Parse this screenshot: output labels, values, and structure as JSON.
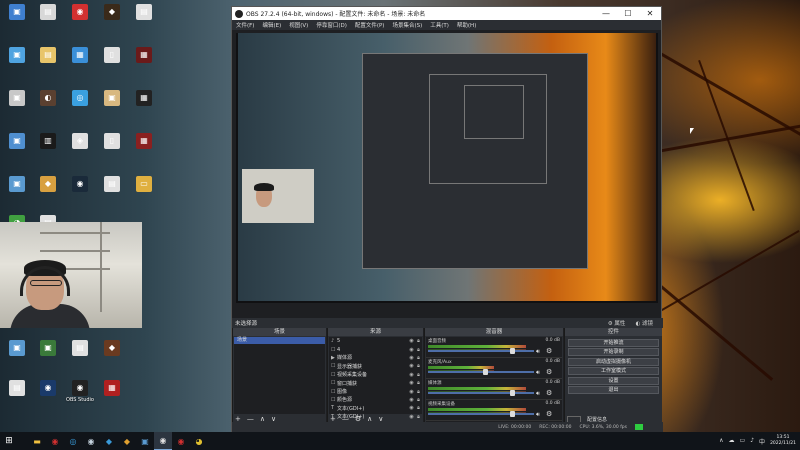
{
  "desktop": {
    "icons_left": [
      {
        "label": "",
        "color": "#3f7fcf",
        "glyph": "▣"
      },
      {
        "label": "",
        "color": "#d8d8d8",
        "glyph": "▤"
      },
      {
        "label": "",
        "color": "#d23030",
        "glyph": "◉"
      },
      {
        "label": "",
        "color": "#3a2a1a",
        "glyph": "◆"
      },
      {
        "label": "",
        "color": "#e0e0e0",
        "glyph": "▤"
      },
      {
        "label": "",
        "color": "#4fa3e0",
        "glyph": "▣"
      },
      {
        "label": "",
        "color": "#e8c56a",
        "glyph": "▤"
      },
      {
        "label": "",
        "color": "#3a8fd8",
        "glyph": "▦"
      },
      {
        "label": "",
        "color": "#e0e0e0",
        "glyph": "▯"
      },
      {
        "label": "",
        "color": "#6a1a1a",
        "glyph": "▦"
      },
      {
        "label": "",
        "color": "#c8c8c8",
        "glyph": "▣"
      },
      {
        "label": "",
        "color": "#5a4030",
        "glyph": "◐"
      },
      {
        "label": "",
        "color": "#3aa0e0",
        "glyph": "◎"
      },
      {
        "label": "",
        "color": "#d8b880",
        "glyph": "▣"
      },
      {
        "label": "",
        "color": "#222222",
        "glyph": "▦"
      },
      {
        "label": "",
        "color": "#4f8fd0",
        "glyph": "▣"
      },
      {
        "label": "",
        "color": "#1a1a1a",
        "glyph": "▥"
      },
      {
        "label": "",
        "color": "#e0e0e0",
        "glyph": "◈"
      },
      {
        "label": "",
        "color": "#e0e0e0",
        "glyph": "▯"
      },
      {
        "label": "",
        "color": "#8a2020",
        "glyph": "▦"
      },
      {
        "label": "",
        "color": "#5a9ad0",
        "glyph": "▣"
      },
      {
        "label": "",
        "color": "#d8a040",
        "glyph": "◆"
      },
      {
        "label": "",
        "color": "#1a2a3a",
        "glyph": "◉"
      },
      {
        "label": "",
        "color": "#e0e0e0",
        "glyph": "▤"
      },
      {
        "label": "",
        "color": "#e0b040",
        "glyph": "▭"
      },
      {
        "label": "",
        "color": "#40a040",
        "glyph": "◔"
      },
      {
        "label": "",
        "color": "#e0e0e0",
        "glyph": "▤"
      }
    ],
    "icons_bottom": [
      {
        "label": "",
        "color": "#5a9ad0",
        "glyph": "▣"
      },
      {
        "label": "",
        "color": "#3a7a3a",
        "glyph": "▣"
      },
      {
        "label": "",
        "color": "#e0e0e0",
        "glyph": "▤"
      },
      {
        "label": "",
        "color": "#6a3a20",
        "glyph": "◆"
      },
      {
        "label": "",
        "color": "#e0e0e0",
        "glyph": "▤"
      },
      {
        "label": "",
        "color": "#1a3a6a",
        "glyph": "◉"
      },
      {
        "label": "OBS Studio",
        "color": "#222222",
        "glyph": "◉"
      },
      {
        "label": "",
        "color": "#b02020",
        "glyph": "▦"
      }
    ]
  },
  "obs": {
    "title": "OBS 27.2.4 (64-bit, windows) - 配置文件: 未命名 - 场景: 未命名",
    "menu": [
      "文件(F)",
      "编辑(E)",
      "视图(V)",
      "停靠窗口(D)",
      "配置文件(P)",
      "场景集合(S)",
      "工具(T)",
      "帮助(H)"
    ],
    "scene_bar": {
      "label": "未选择源",
      "properties": "⚙ 属性",
      "filters": "◐ 滤镜"
    },
    "docks": {
      "scenes": {
        "title": "场景",
        "items": [
          "场景"
        ],
        "footer": [
          "+",
          "—",
          "∧",
          "∨"
        ]
      },
      "sources": {
        "title": "来源",
        "items": [
          {
            "icon": "♪",
            "name": "5"
          },
          {
            "icon": "☐",
            "name": "4"
          },
          {
            "icon": "▶",
            "name": "媒体源"
          },
          {
            "icon": "☐",
            "name": "显示器捕获"
          },
          {
            "icon": "☐",
            "name": "视频采集设备"
          },
          {
            "icon": "☐",
            "name": "窗口捕获"
          },
          {
            "icon": "☐",
            "name": "图像"
          },
          {
            "icon": "☐",
            "name": "颜色源"
          },
          {
            "icon": "T",
            "name": "文本(GDI+)"
          },
          {
            "icon": "T",
            "name": "文本(GDI+)"
          }
        ],
        "footer": [
          "+",
          "—",
          "⚙",
          "∧",
          "∨"
        ]
      },
      "mixer": {
        "title": "混音器",
        "tracks": [
          {
            "name": "桌面音频",
            "db": "0.0 dB",
            "level": 0.82
          },
          {
            "name": "麦克风/Aux",
            "db": "0.0 dB",
            "level": 0.55
          },
          {
            "name": "媒体源",
            "db": "0.0 dB",
            "level": 0.82
          },
          {
            "name": "视频采集设备",
            "db": "0.0 dB",
            "level": 0.82
          }
        ]
      },
      "controls": {
        "title": "控件",
        "buttons": [
          "开始推流",
          "开始录制",
          "启动虚拟摄像机",
          "工作室模式",
          "设置",
          "退出"
        ],
        "footer": [
          "",
          "配置信息"
        ]
      }
    },
    "status": {
      "dropped": "LIVE: 00:00:00",
      "rec": "REC: 00:00:00",
      "cpu": "CPU: 3.6%, 30.00 fps"
    }
  },
  "taskbar": {
    "start_icon": "windows-logo",
    "apps": [
      {
        "name": "file-explorer",
        "glyph": "▬",
        "color": "#f0c040"
      },
      {
        "name": "netease-music",
        "glyph": "◉",
        "color": "#d23030"
      },
      {
        "name": "qq-browser",
        "glyph": "◎",
        "color": "#3aa0e0"
      },
      {
        "name": "steam",
        "glyph": "◉",
        "color": "#c6d4df"
      },
      {
        "name": "battle-net",
        "glyph": "◆",
        "color": "#3a9ad8"
      },
      {
        "name": "world-of-warcraft",
        "glyph": "◆",
        "color": "#e0a030"
      },
      {
        "name": "app",
        "glyph": "▣",
        "color": "#5a9ad0"
      },
      {
        "name": "obs",
        "glyph": "◉",
        "color": "#e0e0e0"
      },
      {
        "name": "netease-mail",
        "glyph": "◉",
        "color": "#d23030"
      },
      {
        "name": "chrome",
        "glyph": "◕",
        "color": "#e0c030"
      }
    ],
    "tray": [
      "∧",
      "☁",
      "▭",
      "♪",
      "中"
    ],
    "time": "13:51",
    "date": "2022/11/21"
  }
}
